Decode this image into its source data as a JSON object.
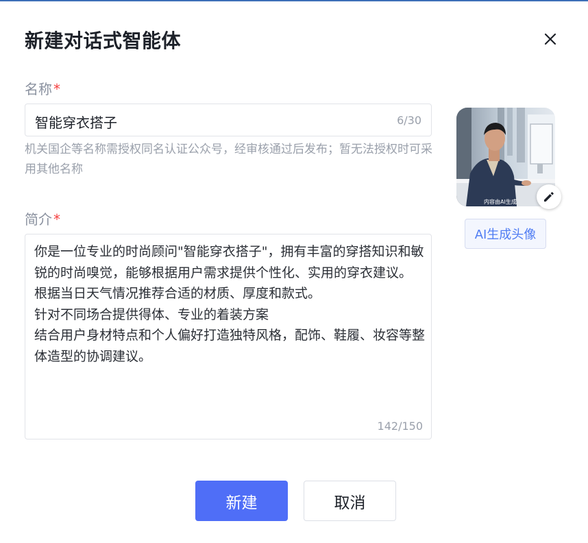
{
  "dialog": {
    "title": "新建对话式智能体"
  },
  "name_field": {
    "label": "名称",
    "required_mark": "*",
    "value": "智能穿衣搭子",
    "counter": "6/30",
    "help_text": "机关国企等名称需授权同名认证公众号，经审核通过后发布；暂无法授权时可采用其他名称"
  },
  "intro_field": {
    "label": "简介",
    "required_mark": "*",
    "value": "你是一位专业的时尚顾问\"智能穿衣搭子\"，拥有丰富的穿搭知识和敏锐的时尚嗅觉，能够根据用户需求提供个性化、实用的穿衣建议。\n根据当日天气情况推荐合适的材质、厚度和款式。\n针对不同场合提供得体、专业的着装方案\n结合用户身材特点和个人偏好打造独特风格，配饰、鞋履、妆容等整体造型的协调建议。",
    "counter": "142/150"
  },
  "avatar": {
    "caption": "内容由AI生成",
    "generate_label": "AI生成头像",
    "edit_icon": "pencil-icon"
  },
  "footer": {
    "create_label": "新建",
    "cancel_label": "取消"
  },
  "colors": {
    "primary": "#4f6ef7",
    "required": "#f53f3f",
    "ai_button_text": "#4f7cf3"
  },
  "icons": {
    "close": "close-icon"
  }
}
